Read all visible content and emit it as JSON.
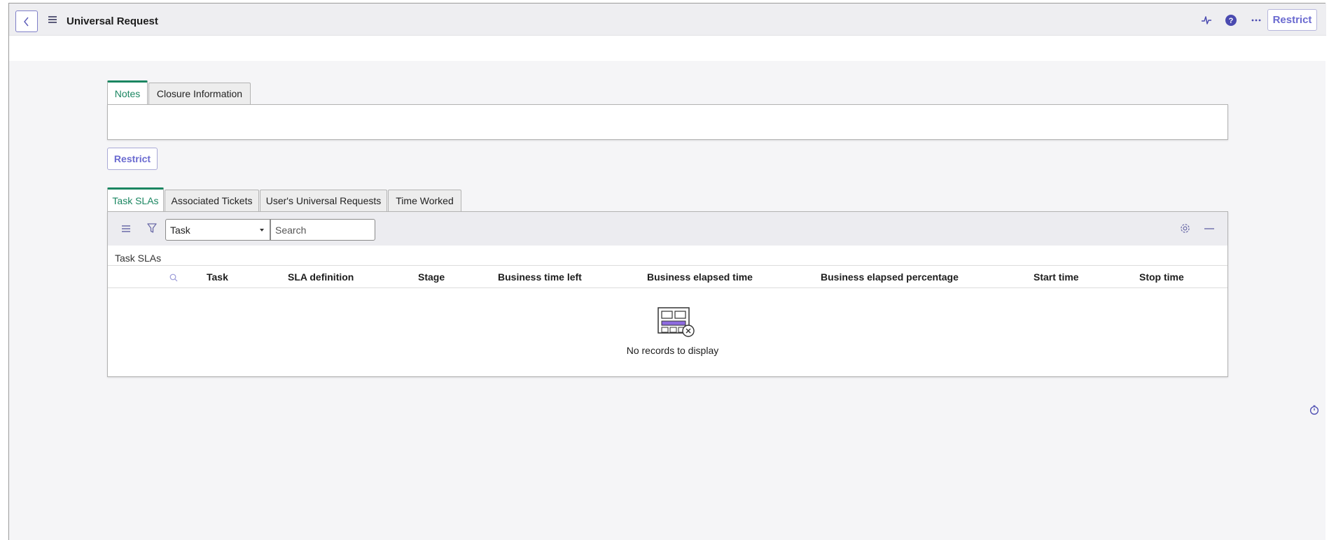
{
  "header": {
    "title": "Universal Request",
    "restrict_label": "Restrict",
    "icons": [
      "chevron-left-icon",
      "menu-icon",
      "activity-icon",
      "help-icon",
      "more-icon"
    ]
  },
  "form_tabs": [
    {
      "label": "Notes",
      "active": true
    },
    {
      "label": "Closure Information",
      "active": false
    }
  ],
  "restrict_button": "Restrict",
  "related_tabs": [
    {
      "label": "Task SLAs",
      "active": true
    },
    {
      "label": "Associated Tickets",
      "active": false
    },
    {
      "label": "User's Universal Requests",
      "active": false
    },
    {
      "label": "Time Worked",
      "active": false
    }
  ],
  "list": {
    "filter_select_value": "Task",
    "search_placeholder": "Search",
    "caption": "Task SLAs",
    "columns": [
      "Task",
      "SLA definition",
      "Stage",
      "Business time left",
      "Business elapsed time",
      "Business elapsed percentage",
      "Start time",
      "Stop time"
    ],
    "empty_message": "No records to display"
  },
  "colors": {
    "accent": "#1b8661",
    "primary": "#6a6ad0",
    "background": "#f5f5f7"
  }
}
